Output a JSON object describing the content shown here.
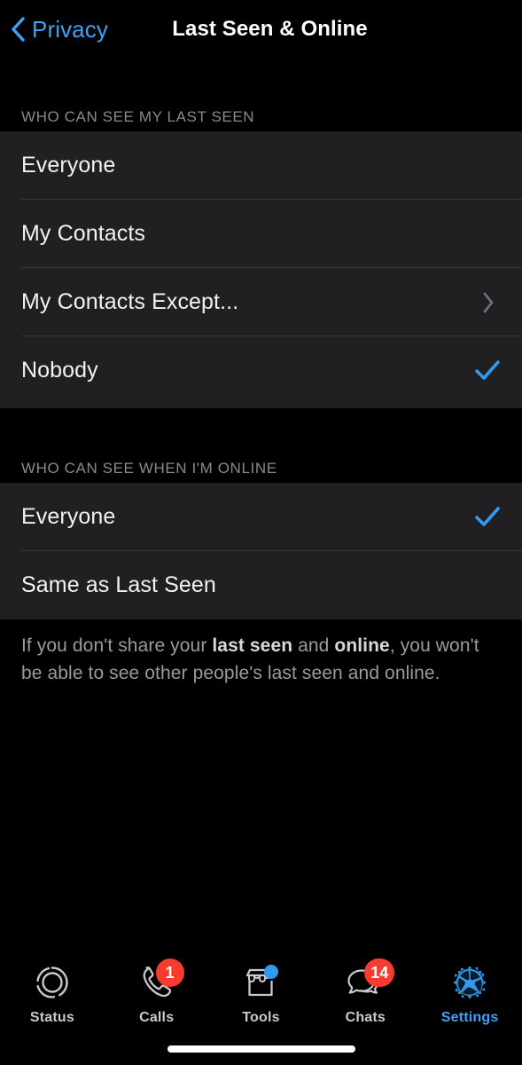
{
  "navbar": {
    "back_label": "Privacy",
    "back_icon": "chevron-left-icon",
    "title": "Last Seen & Online"
  },
  "sections": [
    {
      "header": "WHO CAN SEE MY LAST SEEN",
      "rows": [
        {
          "label": "Everyone",
          "accessory": "none",
          "selected": false
        },
        {
          "label": "My Contacts",
          "accessory": "none",
          "selected": false
        },
        {
          "label": "My Contacts Except...",
          "accessory": "chevron",
          "selected": false
        },
        {
          "label": "Nobody",
          "accessory": "check",
          "selected": true
        }
      ]
    },
    {
      "header": "WHO CAN SEE WHEN I'M ONLINE",
      "rows": [
        {
          "label": "Everyone",
          "accessory": "check",
          "selected": true
        },
        {
          "label": "Same as Last Seen",
          "accessory": "none",
          "selected": false
        }
      ]
    }
  ],
  "footer_note": {
    "part1": "If you don't share your ",
    "bold1": "last seen",
    "part2": " and ",
    "bold2": "online",
    "part3": ", you won't be able to see other people's last seen and online."
  },
  "tabbar": {
    "items": [
      {
        "label": "Status",
        "icon": "status-rings-icon",
        "badge": null,
        "dot": false,
        "active": false
      },
      {
        "label": "Calls",
        "icon": "phone-icon",
        "badge": "1",
        "dot": false,
        "active": false
      },
      {
        "label": "Tools",
        "icon": "storefront-icon",
        "badge": null,
        "dot": true,
        "active": false
      },
      {
        "label": "Chats",
        "icon": "chat-bubbles-icon",
        "badge": "14",
        "dot": false,
        "active": false
      },
      {
        "label": "Settings",
        "icon": "gear-icon",
        "badge": null,
        "dot": false,
        "active": true
      }
    ]
  },
  "colors": {
    "accent_blue": "#3FA2F7",
    "badge_red": "#FA3B2F",
    "card_bg": "#202022",
    "page_bg": "#000000",
    "header_text": "#8A8A8F",
    "row_text": "#F2F2F2",
    "separator": "#3A3A3C"
  }
}
